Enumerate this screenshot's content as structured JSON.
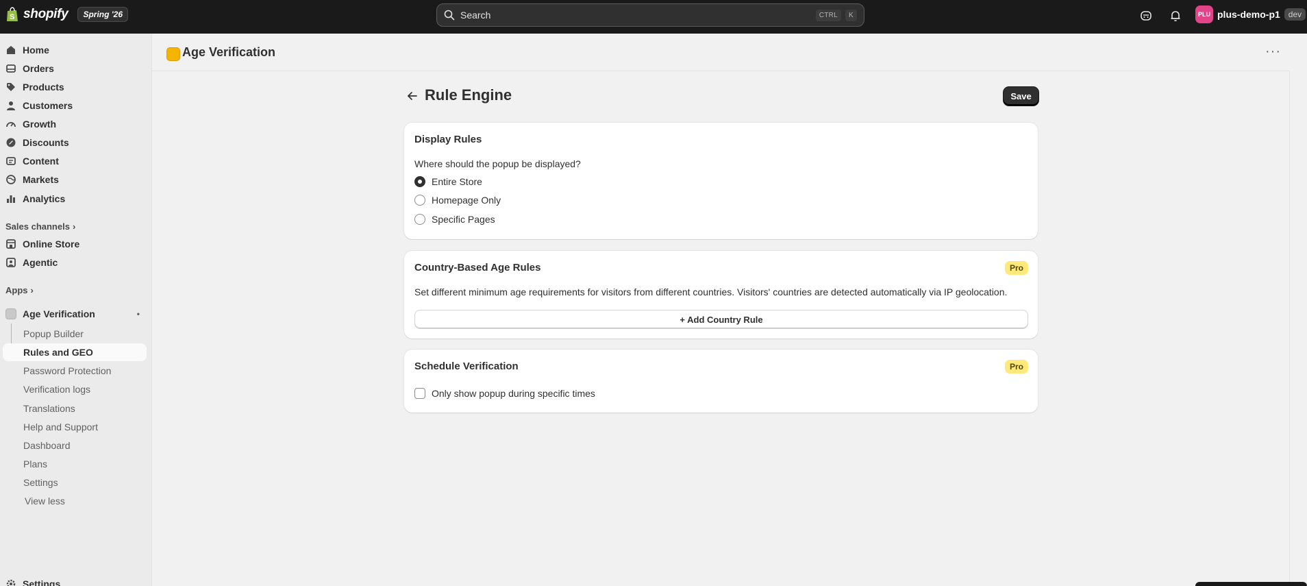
{
  "topbar": {
    "logo_text": "shopify",
    "edition": "Spring '26",
    "search_placeholder": "Search",
    "shortcut_ctrl": "CTRL",
    "shortcut_key": "K",
    "avatar_initials": "PLU",
    "store_name": "plus-demo-p1",
    "dev_badge": "dev"
  },
  "sidebar": {
    "main": [
      {
        "label": "Home",
        "icon": "home-icon"
      },
      {
        "label": "Orders",
        "icon": "inbox-icon"
      },
      {
        "label": "Products",
        "icon": "tag-icon"
      },
      {
        "label": "Customers",
        "icon": "person-icon"
      },
      {
        "label": "Growth",
        "icon": "gauge-icon"
      },
      {
        "label": "Discounts",
        "icon": "discount-icon"
      },
      {
        "label": "Content",
        "icon": "content-icon"
      },
      {
        "label": "Markets",
        "icon": "globe-icon"
      },
      {
        "label": "Analytics",
        "icon": "chart-bar-icon"
      }
    ],
    "sales_channels_label": "Sales channels",
    "channels": [
      {
        "label": "Online Store",
        "icon": "store-icon"
      },
      {
        "label": "Agentic",
        "icon": "agent-icon"
      }
    ],
    "apps_label": "Apps",
    "app_name": "Age Verification",
    "app_sub": [
      "Popup Builder",
      "Rules and GEO",
      "Password Protection",
      "Verification logs",
      "Translations",
      "Help and Support",
      "Dashboard",
      "Plans",
      "Settings"
    ],
    "view_less": "View less",
    "settings": "Settings"
  },
  "app_header": {
    "title": "Age Verification",
    "more": "···"
  },
  "page": {
    "title": "Rule Engine",
    "save_label": "Save"
  },
  "display_rules": {
    "title": "Display Rules",
    "question": "Where should the popup be displayed?",
    "options": [
      "Entire Store",
      "Homepage Only",
      "Specific Pages"
    ],
    "selected": "Entire Store"
  },
  "country_rules": {
    "title": "Country-Based Age Rules",
    "badge": "Pro",
    "description": "Set different minimum age requirements for visitors from different countries. Visitors' countries are detected automatically via IP geolocation.",
    "add_label": "+ Add Country Rule"
  },
  "schedule": {
    "title": "Schedule Verification",
    "badge": "Pro",
    "checkbox_label": "Only show popup during specific times"
  },
  "colors": {
    "topbar": "#1a1a1a",
    "accent": "#303030",
    "pro_badge": "#ffe97a",
    "avatar": "#e2448a",
    "app_icon": "#f5b400"
  }
}
